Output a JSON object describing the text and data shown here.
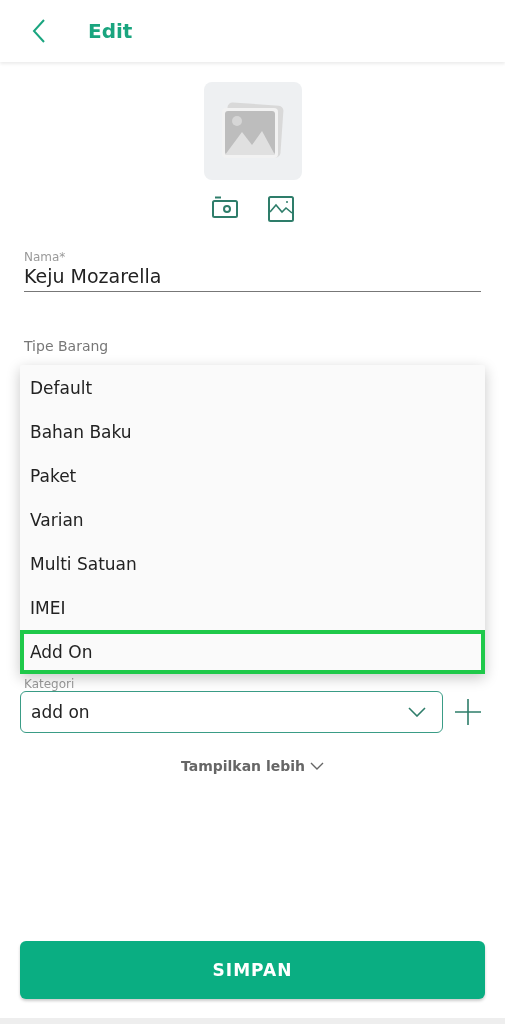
{
  "header": {
    "title": "Edit"
  },
  "name_field": {
    "label": "Nama*",
    "value": "Keju Mozarella"
  },
  "type_field": {
    "label": "Tipe Barang"
  },
  "type_menu": [
    {
      "label": "Default",
      "selected": false
    },
    {
      "label": "Bahan Baku",
      "selected": false
    },
    {
      "label": "Paket",
      "selected": false
    },
    {
      "label": "Varian",
      "selected": false
    },
    {
      "label": "Multi Satuan",
      "selected": false
    },
    {
      "label": "IMEI",
      "selected": false
    },
    {
      "label": "Add On",
      "selected": true
    }
  ],
  "category_field": {
    "label": "Kategori",
    "value": "add on"
  },
  "show_more": "Tampilkan lebih",
  "save_button": "SIMPAN"
}
